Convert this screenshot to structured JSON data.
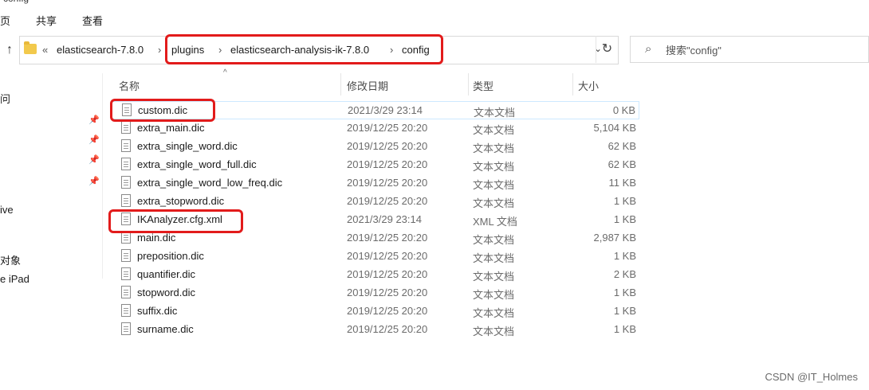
{
  "window": {
    "title_partial": "config"
  },
  "ribbon": {
    "tabs": [
      "页",
      "共享",
      "查看"
    ]
  },
  "address_bar": {
    "overflow": "«",
    "crumbs": [
      "elasticsearch-7.8.0",
      "plugins",
      "elasticsearch-analysis-ik-7.8.0",
      "config"
    ],
    "separator": "›",
    "dropdown_icon": "chevron-down-icon",
    "refresh_icon": "refresh-icon"
  },
  "search": {
    "placeholder": "搜索\"config\"",
    "icon": "search-icon"
  },
  "nav_pane": {
    "items": [
      "问",
      "ive",
      "对象",
      "e iPad"
    ]
  },
  "columns": {
    "name": "名称",
    "date": "修改日期",
    "type": "类型",
    "size": "大小"
  },
  "files": [
    {
      "name": "custom.dic",
      "date": "2021/3/29 23:14",
      "type": "文本文档",
      "size": "0 KB"
    },
    {
      "name": "extra_main.dic",
      "date": "2019/12/25 20:20",
      "type": "文本文档",
      "size": "5,104 KB"
    },
    {
      "name": "extra_single_word.dic",
      "date": "2019/12/25 20:20",
      "type": "文本文档",
      "size": "62 KB"
    },
    {
      "name": "extra_single_word_full.dic",
      "date": "2019/12/25 20:20",
      "type": "文本文档",
      "size": "62 KB"
    },
    {
      "name": "extra_single_word_low_freq.dic",
      "date": "2019/12/25 20:20",
      "type": "文本文档",
      "size": "11 KB"
    },
    {
      "name": "extra_stopword.dic",
      "date": "2019/12/25 20:20",
      "type": "文本文档",
      "size": "1 KB"
    },
    {
      "name": "IKAnalyzer.cfg.xml",
      "date": "2021/3/29 23:14",
      "type": "XML 文档",
      "size": "1 KB"
    },
    {
      "name": "main.dic",
      "date": "2019/12/25 20:20",
      "type": "文本文档",
      "size": "2,987 KB"
    },
    {
      "name": "preposition.dic",
      "date": "2019/12/25 20:20",
      "type": "文本文档",
      "size": "1 KB"
    },
    {
      "name": "quantifier.dic",
      "date": "2019/12/25 20:20",
      "type": "文本文档",
      "size": "2 KB"
    },
    {
      "name": "stopword.dic",
      "date": "2019/12/25 20:20",
      "type": "文本文档",
      "size": "1 KB"
    },
    {
      "name": "suffix.dic",
      "date": "2019/12/25 20:20",
      "type": "文本文档",
      "size": "1 KB"
    },
    {
      "name": "surname.dic",
      "date": "2019/12/25 20:20",
      "type": "文本文档",
      "size": "1 KB"
    }
  ],
  "watermark": "CSDN @IT_Holmes",
  "annotation_color": "#e21b1b"
}
